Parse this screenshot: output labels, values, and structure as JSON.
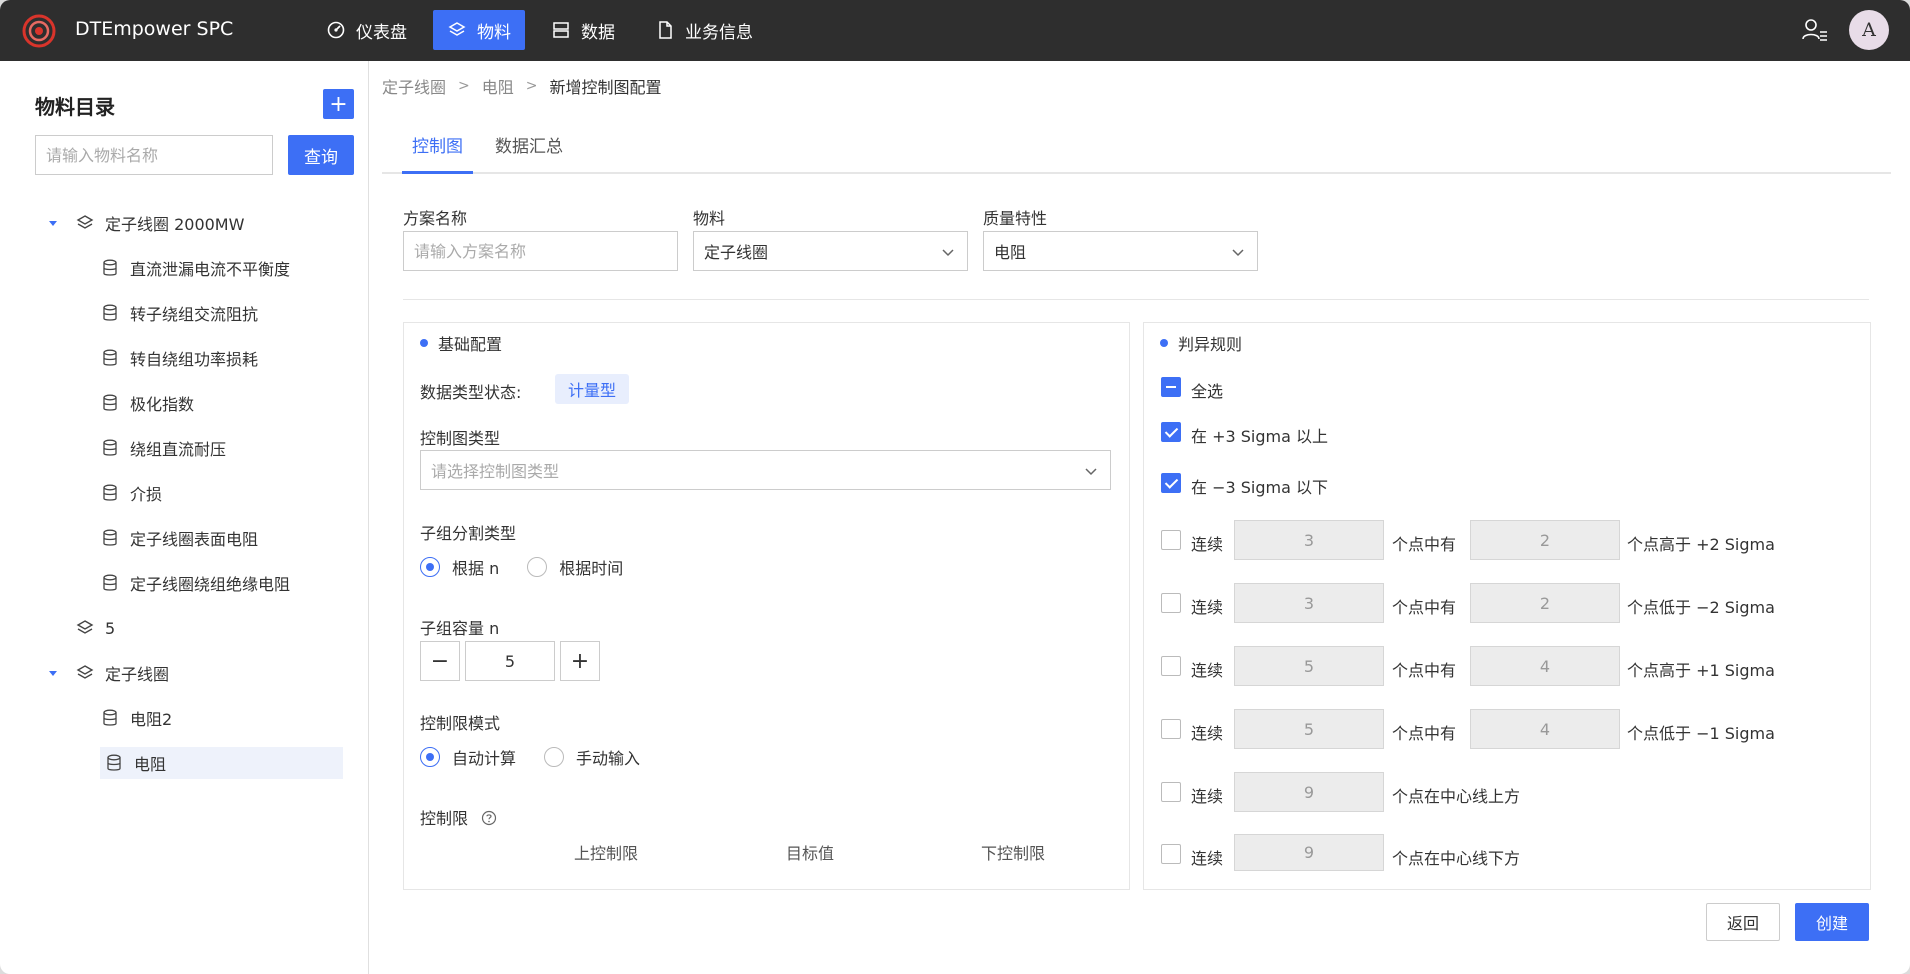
{
  "app": {
    "title": "DTEmpower SPC"
  },
  "nav": [
    {
      "label": "仪表盘",
      "icon": "gauge-icon",
      "active": false
    },
    {
      "label": "物料",
      "icon": "material-icon",
      "active": true
    },
    {
      "label": "数据",
      "icon": "data-icon",
      "active": false
    },
    {
      "label": "业务信息",
      "icon": "document-icon",
      "active": false
    }
  ],
  "user": {
    "avatar_letter": "A"
  },
  "sidebar": {
    "title": "物料目录",
    "add_label": "+",
    "search_placeholder": "请输入物料名称",
    "query_label": "查询",
    "tree": [
      {
        "label": "定子线圈 2000MW",
        "level": 0,
        "expanded": true,
        "type": "material"
      },
      {
        "label": "直流泄漏电流不平衡度",
        "level": 1,
        "type": "characteristic"
      },
      {
        "label": "转子绕组交流阻抗",
        "level": 1,
        "type": "characteristic"
      },
      {
        "label": "转自绕组功率损耗",
        "level": 1,
        "type": "characteristic"
      },
      {
        "label": "极化指数",
        "level": 1,
        "type": "characteristic"
      },
      {
        "label": "绕组直流耐压",
        "level": 1,
        "type": "characteristic"
      },
      {
        "label": "介损",
        "level": 1,
        "type": "characteristic"
      },
      {
        "label": "定子线圈表面电阻",
        "level": 1,
        "type": "characteristic"
      },
      {
        "label": "定子线圈绕组绝缘电阻",
        "level": 1,
        "type": "characteristic"
      },
      {
        "label": "5",
        "level": 0,
        "expanded": false,
        "type": "material"
      },
      {
        "label": "定子线圈",
        "level": 0,
        "expanded": true,
        "type": "material"
      },
      {
        "label": "电阻2",
        "level": 1,
        "type": "characteristic"
      },
      {
        "label": "电阻",
        "level": 1,
        "type": "characteristic",
        "selected": true
      }
    ]
  },
  "breadcrumb": [
    "定子线圈",
    "电阻",
    "新增控制图配置"
  ],
  "tabs": [
    {
      "label": "控制图",
      "active": true
    },
    {
      "label": "数据汇总",
      "active": false
    }
  ],
  "form": {
    "scheme_label": "方案名称",
    "scheme_placeholder": "请输入方案名称",
    "material_label": "物料",
    "material_value": "定子线圈",
    "quality_label": "质量特性",
    "quality_value": "电阻"
  },
  "basic": {
    "title": "基础配置",
    "data_type_label": "数据类型状态:",
    "data_type_value": "计量型",
    "chart_type_label": "控制图类型",
    "chart_type_placeholder": "请选择控制图类型",
    "subgroup_split_label": "子组分割类型",
    "split_options": [
      "根据 n",
      "根据时间"
    ],
    "split_selected": 0,
    "subgroup_size_label": "子组容量 n",
    "subgroup_size_value": "5",
    "minus": "−",
    "plus": "+",
    "limit_mode_label": "控制限模式",
    "limit_mode_options": [
      "自动计算",
      "手动输入"
    ],
    "limit_mode_selected": 0,
    "limit_label": "控制限",
    "limit_cols": [
      "上控制限",
      "目标值",
      "下控制限"
    ]
  },
  "rules": {
    "title": "判异规则",
    "select_all": "全选",
    "rule_above": "在 +3 Sigma 以上",
    "rule_below": "在 −3 Sigma 以下",
    "consecutive": "连续",
    "points_have": "个点中有",
    "rows": [
      {
        "n": "3",
        "m": "2",
        "suffix": "个点高于 +2 Sigma"
      },
      {
        "n": "3",
        "m": "2",
        "suffix": "个点低于 −2 Sigma"
      },
      {
        "n": "5",
        "m": "4",
        "suffix": "个点高于 +1 Sigma"
      },
      {
        "n": "5",
        "m": "4",
        "suffix": "个点低于 −1 Sigma"
      }
    ],
    "center_above": {
      "n": "9",
      "suffix": "个点在中心线上方"
    },
    "center_below": {
      "n": "9",
      "suffix": "个点在中心线下方"
    }
  },
  "actions": {
    "back": "返回",
    "create": "创建"
  },
  "colors": {
    "accent": "#3d6ff5",
    "topbar": "#2e2e2e",
    "selected_bg": "#eef2fb",
    "logo_red": "#d9342b"
  }
}
